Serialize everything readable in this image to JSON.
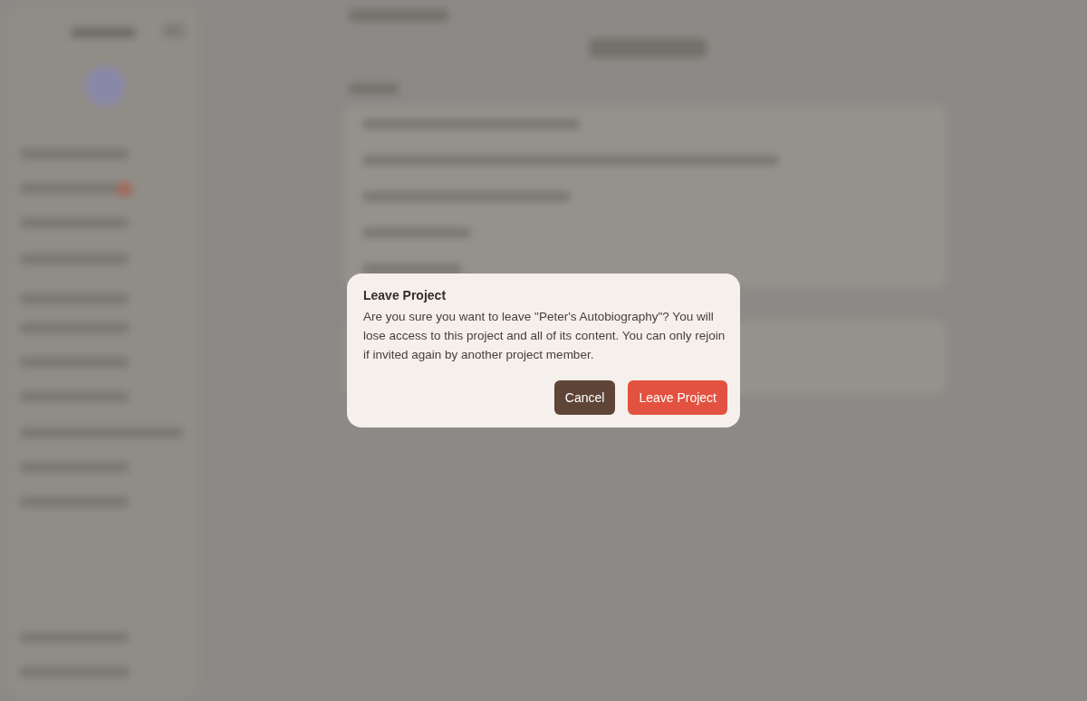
{
  "dialog": {
    "title": "Leave Project",
    "message": "Are you sure you want to leave \"Peter's Autobiography\"? You will lose access to this project and all of its content. You can only rejoin if invited again by another project member.",
    "buttons": [
      {
        "label": "Cancel",
        "kind": "secondary"
      },
      {
        "label": "Leave Project",
        "kind": "danger"
      }
    ]
  }
}
